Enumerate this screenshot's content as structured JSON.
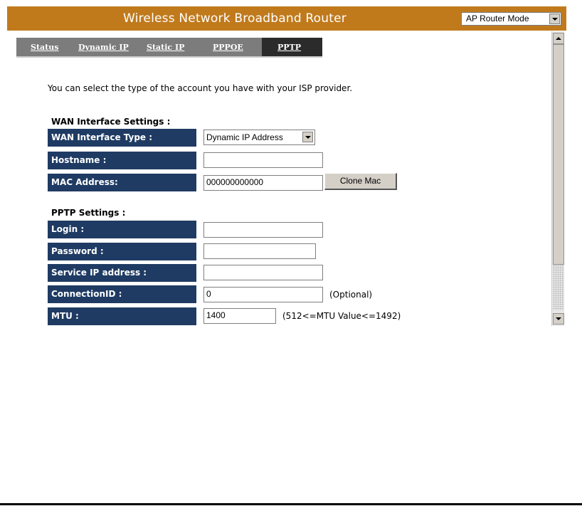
{
  "header": {
    "title": "Wireless Network Broadband Router",
    "mode_select": "AP Router Mode"
  },
  "tabs": [
    {
      "label": "Status"
    },
    {
      "label": "Dynamic IP"
    },
    {
      "label": "Static IP"
    },
    {
      "label": "PPPOE"
    },
    {
      "label": "PPTP"
    }
  ],
  "intro": "You can select the type of the account you have with your ISP provider.",
  "wan": {
    "section_title": "WAN Interface Settings :",
    "type_label": "WAN Interface Type :",
    "type_value": "Dynamic IP Address",
    "hostname_label": "Hostname :",
    "hostname_value": "",
    "mac_label": "MAC Address:",
    "mac_value": "000000000000",
    "clone_button": "Clone Mac"
  },
  "pptp": {
    "section_title": "PPTP Settings :",
    "login_label": "Login :",
    "login_value": "",
    "password_label": "Password :",
    "password_value": "",
    "service_ip_label": "Service IP address :",
    "service_ip_value": "",
    "connection_id_label": "ConnectionID :",
    "connection_id_value": "0",
    "connection_id_note": "(Optional)",
    "mtu_label": "MTU :",
    "mtu_value": "1400",
    "mtu_note": "(512<=MTU Value<=1492)"
  },
  "colors": {
    "header_bg": "#c07a1c",
    "label_bg": "#1f3b63",
    "tab_bg": "#7c7c7c",
    "tab_active_bg": "#2b2b2b"
  }
}
